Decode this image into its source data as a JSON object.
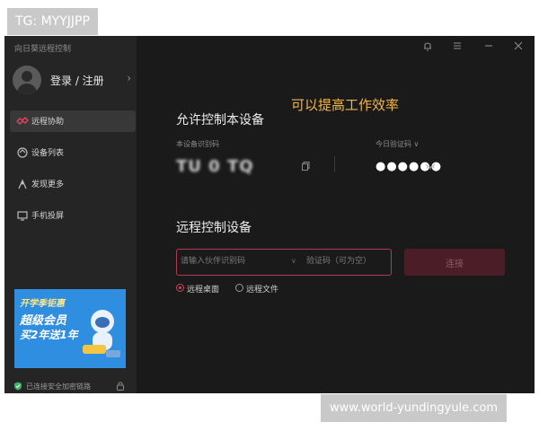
{
  "watermark": {
    "top": "TG: MYYJJPP",
    "bottom": "www.world-yundingyule.com"
  },
  "app": {
    "title": "向日葵远程控制",
    "window_controls": [
      "bell-icon",
      "menu-icon",
      "minimize-icon",
      "close-icon"
    ]
  },
  "sidebar": {
    "login": "登录 / 注册",
    "items": [
      {
        "label": "远程协助",
        "icon": "remote-assist-icon",
        "active": true
      },
      {
        "label": "设备列表",
        "icon": "device-list-icon",
        "active": false
      },
      {
        "label": "发现更多",
        "icon": "discover-icon",
        "active": false
      },
      {
        "label": "手机投屏",
        "icon": "screen-cast-icon",
        "active": false
      }
    ],
    "promo": {
      "tag": "开学季钜惠",
      "line1": "超级会员",
      "line2": "买2年送1年"
    },
    "secure_text": "已连接安全加密链路"
  },
  "main": {
    "overlay_caption": "可以提高工作效率",
    "allow": {
      "title": "允许控制本设备",
      "id_label": "本设备识别码",
      "id_value": "TU 0 TQ",
      "code_label": "今日验证码 ∨",
      "code_value": "●●●●●●"
    },
    "remote": {
      "title": "远程控制设备",
      "id_placeholder": "请输入伙伴识别码",
      "code_placeholder": "验证码（可为空）",
      "connect": "连接",
      "options": [
        {
          "label": "远程桌面",
          "selected": true
        },
        {
          "label": "远程文件",
          "selected": false
        }
      ]
    }
  },
  "colors": {
    "accent": "#d9415c",
    "caption": "#f2b54a",
    "sidebar_bg": "#252526",
    "main_bg": "#1a1a1a"
  }
}
